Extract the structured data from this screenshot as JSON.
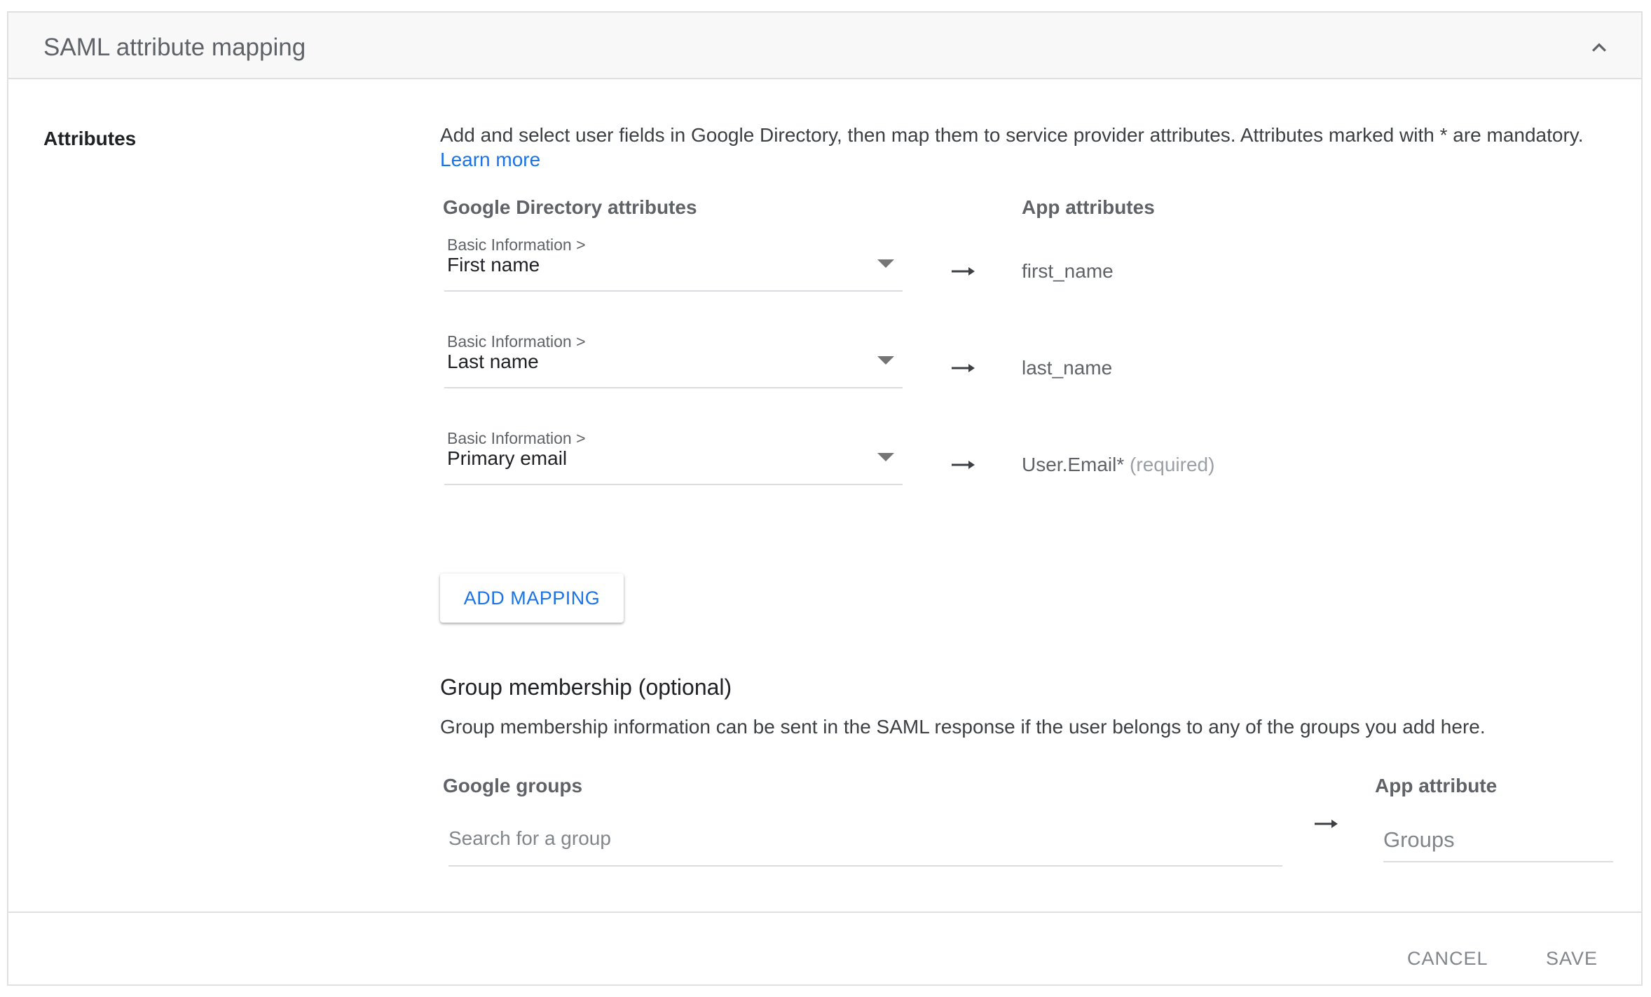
{
  "header": {
    "title": "SAML attribute mapping",
    "collapse_icon": "chevron-up-icon"
  },
  "attributes": {
    "section_label": "Attributes",
    "description": "Add and select user fields in Google Directory, then map them to service provider attributes. Attributes marked with * are mandatory.",
    "learn_more": "Learn more",
    "directory_header": "Google Directory attributes",
    "app_header": "App attributes",
    "mappings": [
      {
        "category": "Basic Information >",
        "field": "First name",
        "app_attribute": "first_name",
        "required_note": ""
      },
      {
        "category": "Basic Information >",
        "field": "Last name",
        "app_attribute": "last_name",
        "required_note": ""
      },
      {
        "category": "Basic Information >",
        "field": "Primary email",
        "app_attribute": "User.Email*",
        "required_note": "(required)"
      }
    ],
    "add_mapping_label": "ADD MAPPING"
  },
  "group_membership": {
    "title": "Group membership (optional)",
    "description": "Group membership information can be sent in the SAML response if the user belongs to any of the groups you add here.",
    "groups_header": "Google groups",
    "search_placeholder": "Search for a group",
    "app_attribute_header": "App attribute",
    "app_attribute_placeholder": "Groups"
  },
  "footer": {
    "cancel_label": "CANCEL",
    "save_label": "SAVE"
  },
  "colors": {
    "accent": "#1a73e8",
    "header_bg": "#f8f8f8",
    "border": "#e0e0e0"
  }
}
